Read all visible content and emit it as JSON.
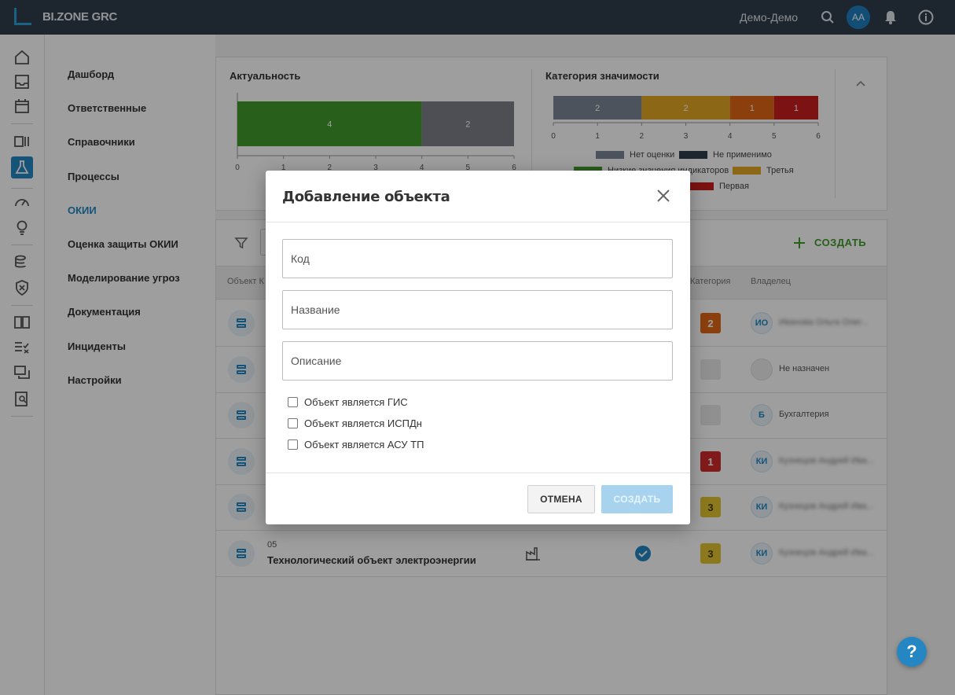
{
  "app": {
    "logo_text": "BI.ZONE GRC",
    "user_name": "Демо-Демо",
    "avatar_initials": "AA"
  },
  "subnav": {
    "items": [
      {
        "label": "Дашборд"
      },
      {
        "label": "Ответственные"
      },
      {
        "label": "Справочники"
      },
      {
        "label": "Процессы"
      },
      {
        "label": "ОКИИ",
        "active": true
      },
      {
        "label": "Оценка защиты ОКИИ"
      },
      {
        "label": "Моделирование угроз"
      },
      {
        "label": "Документация"
      },
      {
        "label": "Инциденты"
      },
      {
        "label": "Настройки"
      }
    ]
  },
  "charts": {
    "actuality": {
      "title": "Актуальность",
      "ticks": [
        "0",
        "1",
        "2",
        "3",
        "4",
        "5",
        "6"
      ],
      "segments": [
        {
          "value": 4,
          "label": "4",
          "color": "#3f9a2c"
        },
        {
          "value": 2,
          "label": "2",
          "color": "#7c8088"
        }
      ]
    },
    "significance": {
      "title": "Категория значимости",
      "ticks": [
        "0",
        "1",
        "2",
        "3",
        "4",
        "5",
        "6"
      ],
      "segments": [
        {
          "value": 2,
          "label": "2",
          "color": "#7d8796"
        },
        {
          "value": 2,
          "label": "2",
          "color": "#e3a623"
        },
        {
          "value": 1,
          "label": "1",
          "color": "#e06615"
        },
        {
          "value": 1,
          "label": "1",
          "color": "#c81e1e"
        }
      ],
      "legend": [
        {
          "label": "Нет оценки",
          "color": "#7d8796"
        },
        {
          "label": "Не применимо",
          "color": "#2f3d4c"
        },
        {
          "label": "Низкие значения индикаторов",
          "color": "#3f9a2c"
        },
        {
          "label": "Третья",
          "color": "#e3a623"
        },
        {
          "label": "Первая",
          "color": "#c81e1e"
        }
      ]
    }
  },
  "table": {
    "create_label": "СОЗДАТЬ",
    "columns": {
      "object": "Объект К",
      "category": "Категория",
      "owner": "Владелец"
    },
    "rows": [
      {
        "badge": "2",
        "badge_color": "#e06615",
        "owner_initials": "ИО",
        "owner_name": "Иванова Ольга Олег...",
        "blurred": true
      },
      {
        "badge": "",
        "badge_color": "#e9e9e9",
        "owner_initials": "",
        "owner_name": "Не назначен",
        "blurred": false
      },
      {
        "badge": "",
        "badge_color": "#e9e9e9",
        "owner_initials": "Б",
        "owner_name": "Бухгалтерия",
        "blurred": false
      },
      {
        "badge": "1",
        "badge_color": "#d12c2c",
        "owner_initials": "КИ",
        "owner_name": "Кузнецов Андрей Ива...",
        "blurred": true
      },
      {
        "badge": "3",
        "badge_color": "#e2c330",
        "owner_initials": "КИ",
        "owner_name": "Кузнецов Андрей Ива...",
        "blurred": true
      },
      {
        "code": "05",
        "name": "Технологический объект электроэнергии",
        "badge": "3",
        "badge_color": "#e2c330",
        "owner_initials": "КИ",
        "owner_name": "Кузнецов Андрей Ива...",
        "blurred": true
      }
    ]
  },
  "modal": {
    "title": "Добавление объекта",
    "fields": {
      "code": {
        "placeholder": "Код",
        "value": ""
      },
      "name": {
        "placeholder": "Название",
        "value": ""
      },
      "description": {
        "placeholder": "Описание",
        "value": ""
      }
    },
    "checkboxes": [
      {
        "label": "Объект является ГИС",
        "checked": false
      },
      {
        "label": "Объект является ИСПДн",
        "checked": false
      },
      {
        "label": "Объект является АСУ ТП",
        "checked": false
      }
    ],
    "cancel_label": "ОТМЕНА",
    "create_label": "СОЗДАТЬ"
  },
  "help": {
    "label": "?"
  },
  "colors": {
    "accent": "#2586c4",
    "topbar": "#2f3d4c"
  }
}
